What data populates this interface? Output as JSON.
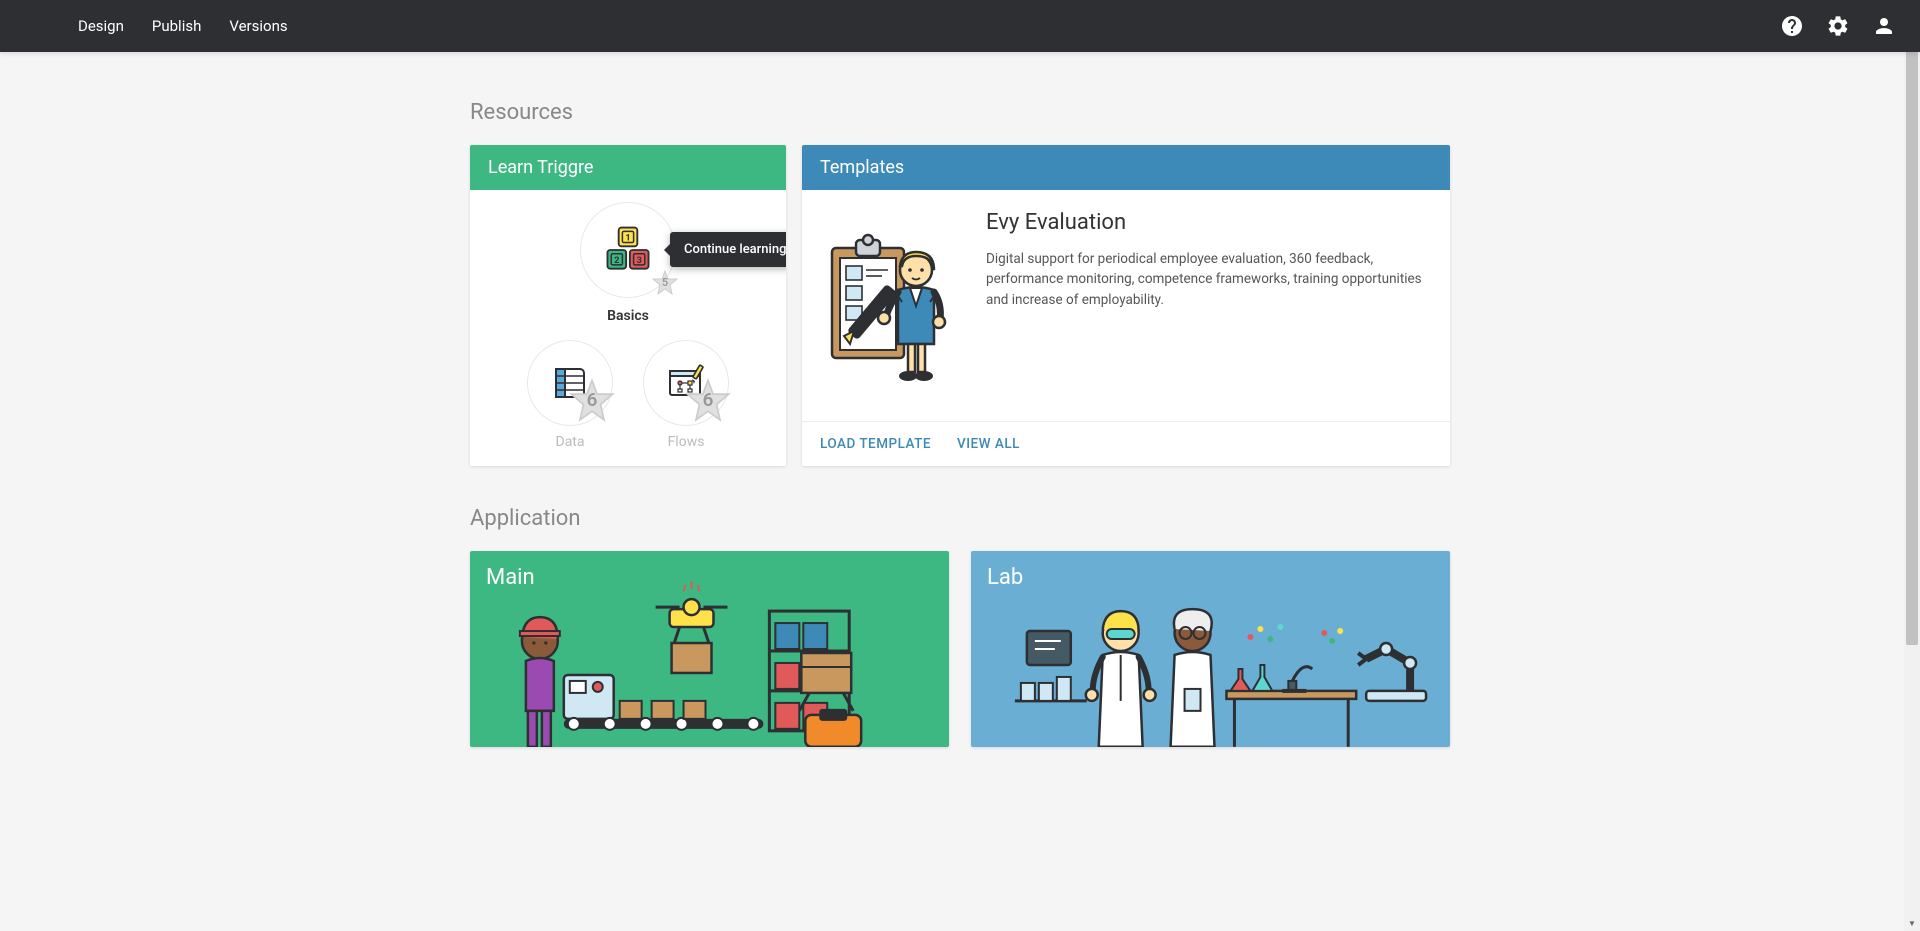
{
  "nav": {
    "items": [
      "Design",
      "Publish",
      "Versions"
    ]
  },
  "sections": {
    "resources": "Resources",
    "application": "Application"
  },
  "learn": {
    "header": "Learn Triggre",
    "tooltip": "Continue learning where you left off",
    "topics": [
      {
        "label": "Basics",
        "badge": "5"
      },
      {
        "label": "Data",
        "badge": "6"
      },
      {
        "label": "Flows",
        "badge": "6"
      }
    ]
  },
  "templates": {
    "header": "Templates",
    "title": "Evy Evaluation",
    "description": "Digital support for periodical employee evaluation, 360 feedback, performance monitoring, competence frameworks, training opportunities and increase of employability.",
    "actions": {
      "load": "LOAD TEMPLATE",
      "viewAll": "VIEW ALL"
    }
  },
  "apps": {
    "main": "Main",
    "lab": "Lab"
  }
}
